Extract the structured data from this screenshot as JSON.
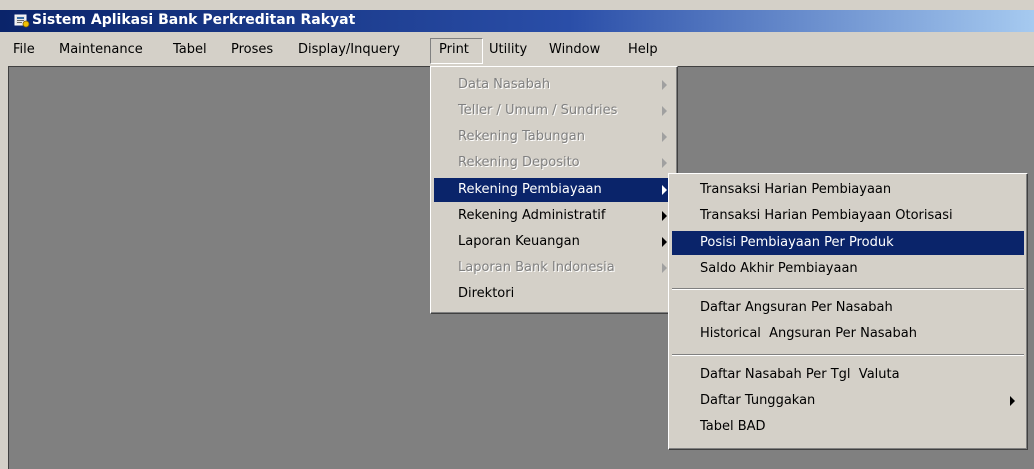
{
  "window": {
    "title": "Sistem Aplikasi Bank Perkreditan Rakyat",
    "icon": "bank-app-icon"
  },
  "menubar": {
    "items": [
      "File",
      "Maintenance",
      "Tabel",
      "Proses",
      "Display/Inquery",
      "Print",
      "Utility",
      "Window",
      "Help"
    ],
    "active": "Print"
  },
  "print_menu": {
    "items": [
      {
        "label": "Data Nasabah",
        "enabled": false,
        "submenu": true
      },
      {
        "label": "Teller / Umum / Sundries",
        "enabled": false,
        "submenu": true
      },
      {
        "label": "Rekening Tabungan",
        "enabled": false,
        "submenu": true
      },
      {
        "label": "Rekening Deposito",
        "enabled": false,
        "submenu": true
      },
      {
        "label": "Rekening Pembiayaan",
        "enabled": true,
        "submenu": true,
        "highlighted": true
      },
      {
        "label": "Rekening Administratif",
        "enabled": true,
        "submenu": true
      },
      {
        "label": "Laporan Keuangan",
        "enabled": true,
        "submenu": true
      },
      {
        "label": "Laporan Bank Indonesia",
        "enabled": false,
        "submenu": true
      },
      {
        "label": "Direktori",
        "enabled": true,
        "submenu": false
      }
    ]
  },
  "pembiayaan_submenu": {
    "items": [
      {
        "label": "Transaksi Harian Pembiayaan",
        "submenu": false
      },
      {
        "label": "Transaksi Harian Pembiayaan Otorisasi",
        "submenu": false
      },
      {
        "label": "Posisi Pembiayaan Per Produk",
        "submenu": false,
        "highlighted": true
      },
      {
        "label": "Saldo Akhir Pembiayaan",
        "submenu": false
      },
      {
        "label": "Daftar Angsuran Per Nasabah",
        "submenu": false
      },
      {
        "label": "Historical  Angsuran Per Nasabah",
        "submenu": false
      },
      {
        "label": "Daftar Nasabah Per Tgl  Valuta",
        "submenu": false
      },
      {
        "label": "Daftar Tunggakan",
        "submenu": true
      },
      {
        "label": "Tabel BAD",
        "submenu": false
      }
    ]
  },
  "colors": {
    "titlebar_start": "#0a246a",
    "titlebar_end": "#a6caf0",
    "highlight": "#0a246a",
    "mdi_background": "#808080",
    "face": "#d4d0c8"
  }
}
